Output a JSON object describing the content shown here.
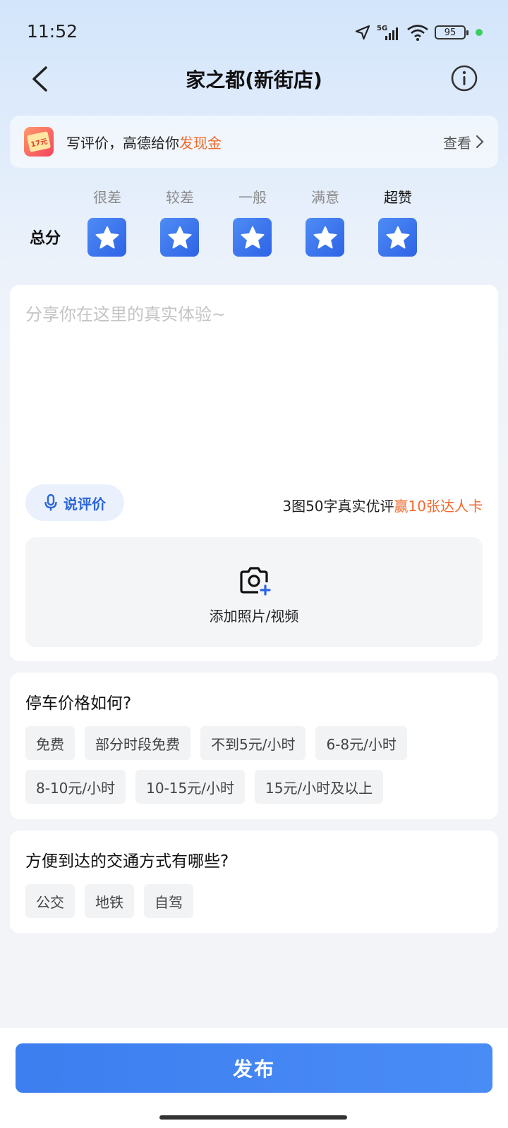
{
  "status_bar": {
    "time": "11:52",
    "battery": "95"
  },
  "nav": {
    "title": "家之都(新街店)"
  },
  "promo": {
    "text_prefix": "写评价，高德给你",
    "text_highlight": "发现金",
    "badge": "17元",
    "view_label": "查看"
  },
  "rating": {
    "label": "总分",
    "levels": [
      "很差",
      "较差",
      "一般",
      "满意",
      "超赞"
    ],
    "selected_index": 4,
    "value": 5,
    "max": 5
  },
  "review": {
    "placeholder": "分享你在这里的真实体验~",
    "voice_label": "说评价",
    "hint_prefix": "3图50字真实优评",
    "hint_highlight": "赢10张达人卡",
    "upload_label": "添加照片/视频"
  },
  "parking": {
    "question": "停车价格如何?",
    "options": [
      "免费",
      "部分时段免费",
      "不到5元/小时",
      "6-8元/小时",
      "8-10元/小时",
      "10-15元/小时",
      "15元/小时及以上"
    ]
  },
  "transport": {
    "question": "方便到达的交通方式有哪些?",
    "options": [
      "公交",
      "地铁",
      "自驾"
    ]
  },
  "footer": {
    "publish_label": "发布"
  },
  "colors": {
    "accent": "#3d7ef0",
    "highlight": "#f06a2d",
    "star": "#2d63e6"
  }
}
